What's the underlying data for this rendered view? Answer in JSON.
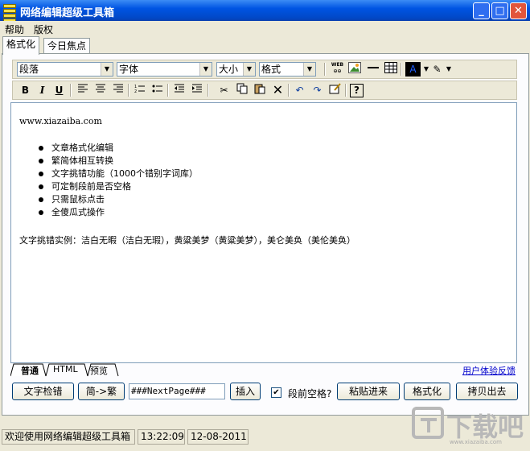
{
  "window": {
    "title": "网络编辑超级工具箱"
  },
  "window_buttons": {
    "minimize": "_",
    "maximize": "□",
    "close": "✕"
  },
  "menu": [
    "帮助",
    "版权"
  ],
  "tabs": [
    "格式化",
    "今日焦点"
  ],
  "toolbar1": {
    "paragraph": "段落",
    "font": "字体",
    "size": "大小",
    "format": "格式",
    "web_icon_text": "WEB"
  },
  "toolbar2": {
    "bold": "B",
    "italic": "I",
    "underline": "U"
  },
  "editor": {
    "url": "www.xiazaiba.com",
    "bullets": [
      "文章格式化编辑",
      "繁简体相互转换",
      "文字挑错功能（1000个错别字词库）",
      "可定制段前是否空格",
      "只需鼠标点击",
      "全傻瓜式操作"
    ],
    "sample": "文字挑错实例：洁白无暇（洁白无瑕），黄粱美梦（黄粱美梦），美仑美奂（美伦美奂）"
  },
  "mode_tabs": [
    "普通",
    "HTML",
    "预览"
  ],
  "feedback_link": "用户体验反馈",
  "actions": {
    "check": "文字检错",
    "convert": "简->繁",
    "nextpage_value": "###NextPage###",
    "insert": "插入",
    "space_label": "段前空格?",
    "space_checked": true,
    "paste": "粘贴进来",
    "format": "格式化",
    "copy_out": "拷贝出去"
  },
  "status": {
    "welcome": "欢迎使用网络编辑超级工具箱",
    "time": "13:22:09",
    "date": "12-08-2011"
  },
  "watermark": {
    "text": "下载吧",
    "url": "www.xiazaiba.com"
  },
  "colors": {
    "title_bar": "#0054e3",
    "link": "#0000cc"
  }
}
